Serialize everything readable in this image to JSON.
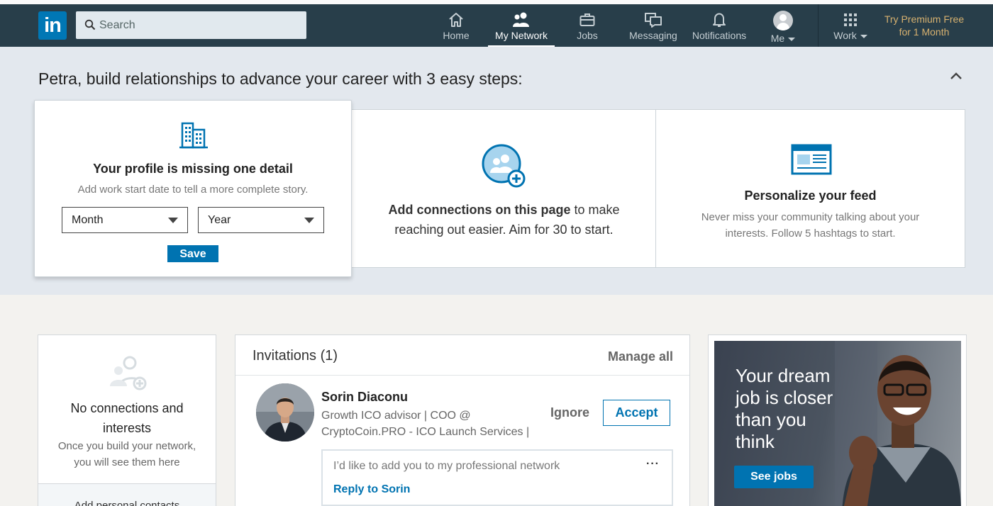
{
  "colors": {
    "nav_bg": "#283e4a",
    "brand": "#0077b5",
    "accent": "#0073b1",
    "premium": "#d7b16f"
  },
  "nav": {
    "logo_text": "in",
    "search_placeholder": "Search",
    "items": [
      {
        "label": "Home",
        "icon": "home-icon"
      },
      {
        "label": "My Network",
        "icon": "people-icon"
      },
      {
        "label": "Jobs",
        "icon": "briefcase-icon"
      },
      {
        "label": "Messaging",
        "icon": "chat-icon"
      },
      {
        "label": "Notifications",
        "icon": "bell-icon"
      },
      {
        "label": "Me",
        "icon": "avatar"
      },
      {
        "label": "Work",
        "icon": "grid-icon"
      }
    ],
    "active": "My Network",
    "premium_line1": "Try Premium Free",
    "premium_line2": "for 1 Month"
  },
  "hero": {
    "title": "Petra, build relationships to advance your career with 3 easy steps:",
    "step1": {
      "heading": "Your profile is missing one detail",
      "sub": "Add work start date to tell a more complete story.",
      "month": "Month",
      "year": "Year",
      "save": "Save"
    },
    "step2": {
      "bold": "Add connections on this page",
      "rest1": " to make",
      "line2": "reaching out easier. Aim for 30 to start."
    },
    "step3": {
      "heading": "Personalize your feed",
      "line1": "Never miss your community talking about your",
      "line2": "interests. Follow 5 hashtags to start."
    }
  },
  "connections": {
    "title_line1": "No connections and",
    "title_line2": "interests",
    "sub_line1": "Once you build your network,",
    "sub_line2": "you will see them here",
    "footer": "Add personal contacts"
  },
  "invitations": {
    "title": "Invitations (1)",
    "manage": "Manage all",
    "name": "Sorin Diaconu",
    "headline1": "Growth ICO advisor | COO @",
    "headline2": "CryptoCoin.PRO - ICO Launch Services |",
    "ignore": "Ignore",
    "accept": "Accept",
    "message": "I’d like to add you to my professional network",
    "reply": "Reply to Sorin",
    "more": "···"
  },
  "ad": {
    "line1": "Your dream",
    "line2": "job is closer",
    "line3": "than you",
    "line4": "think",
    "button": "See jobs"
  }
}
